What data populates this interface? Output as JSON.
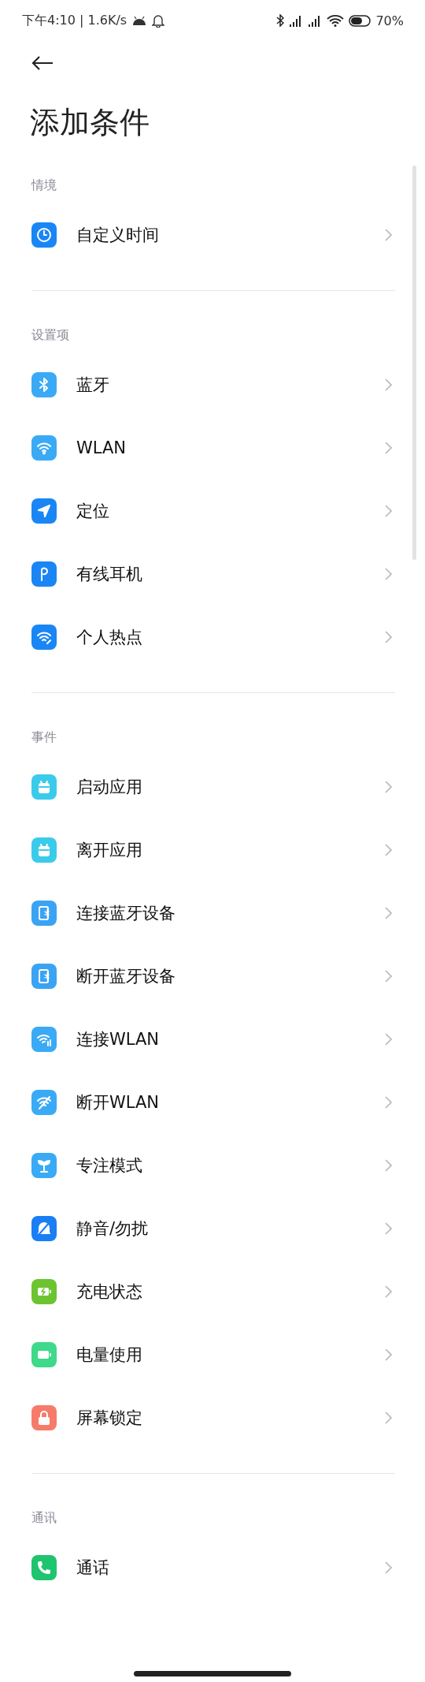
{
  "status_bar": {
    "time_speed": "下午4:10 | 1.6K/s",
    "battery": "70%"
  },
  "title": "添加条件",
  "sections": [
    {
      "header": "情境",
      "items": [
        {
          "label": "自定义时间",
          "kind": "clock",
          "color": "#1a86f5"
        }
      ]
    },
    {
      "header": "设置项",
      "items": [
        {
          "label": "蓝牙",
          "kind": "bluetooth",
          "color": "#3aaaf6"
        },
        {
          "label": "WLAN",
          "kind": "wifi",
          "color": "#3aaaf6"
        },
        {
          "label": "定位",
          "kind": "location",
          "color": "#1a86f5"
        },
        {
          "label": "有线耳机",
          "kind": "earphone",
          "color": "#1a86f5"
        },
        {
          "label": "个人热点",
          "kind": "hotspot",
          "color": "#1a86f5"
        }
      ]
    },
    {
      "header": "事件",
      "items": [
        {
          "label": "启动应用",
          "kind": "app",
          "color": "#3bcbea"
        },
        {
          "label": "离开应用",
          "kind": "app",
          "color": "#3bcbea"
        },
        {
          "label": "连接蓝牙设备",
          "kind": "btdevice",
          "color": "#3aa3f4"
        },
        {
          "label": "断开蓝牙设备",
          "kind": "btdevice",
          "color": "#3aa3f4"
        },
        {
          "label": "连接WLAN",
          "kind": "wificonnect",
          "color": "#3aaaf6"
        },
        {
          "label": "断开WLAN",
          "kind": "wifioff",
          "color": "#3aaaf6"
        },
        {
          "label": "专注模式",
          "kind": "sprout",
          "color": "#3aaaf6"
        },
        {
          "label": "静音/勿扰",
          "kind": "bellmute",
          "color": "#1a7ef5"
        },
        {
          "label": "充电状态",
          "kind": "charging",
          "color": "#6cc431"
        },
        {
          "label": "电量使用",
          "kind": "battery",
          "color": "#3ed98a"
        },
        {
          "label": "屏幕锁定",
          "kind": "lock",
          "color": "#f77b6b"
        }
      ]
    },
    {
      "header": "通讯",
      "items": [
        {
          "label": "通话",
          "kind": "phone",
          "color": "#1fc46f"
        }
      ]
    }
  ]
}
